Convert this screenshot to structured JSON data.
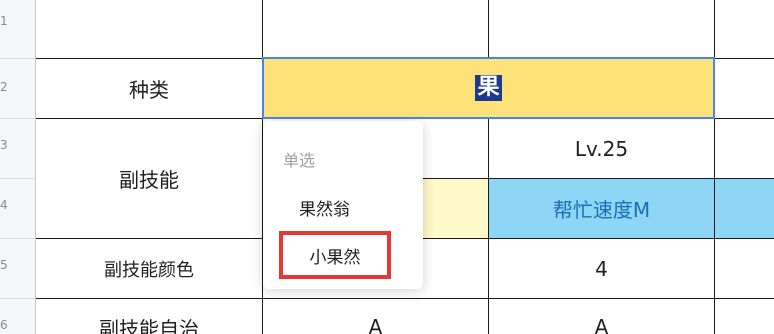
{
  "row_numbers": [
    "1",
    "2",
    "3",
    "4",
    "5",
    "6"
  ],
  "labels": {
    "type": "种类",
    "sub_skill": "副技能",
    "sub_skill_color": "副技能颜色",
    "sub_skill_partial": "副技能自治"
  },
  "cells": {
    "type_value": "果",
    "level": "Lv.25",
    "skill_name": "帮忙速度M",
    "color_value": "4",
    "row6_col2": "A",
    "row6_col3": "A"
  },
  "dropdown": {
    "title": "单选",
    "options": [
      "果然翁",
      "小果然"
    ],
    "highlighted_option": "小果然"
  },
  "colors": {
    "type_fill": "#fde27a",
    "selection_border": "#4a86e8",
    "pale_yellow": "#fff8c9",
    "light_blue": "#8fd5f5",
    "highlight_box": "#e53935"
  }
}
